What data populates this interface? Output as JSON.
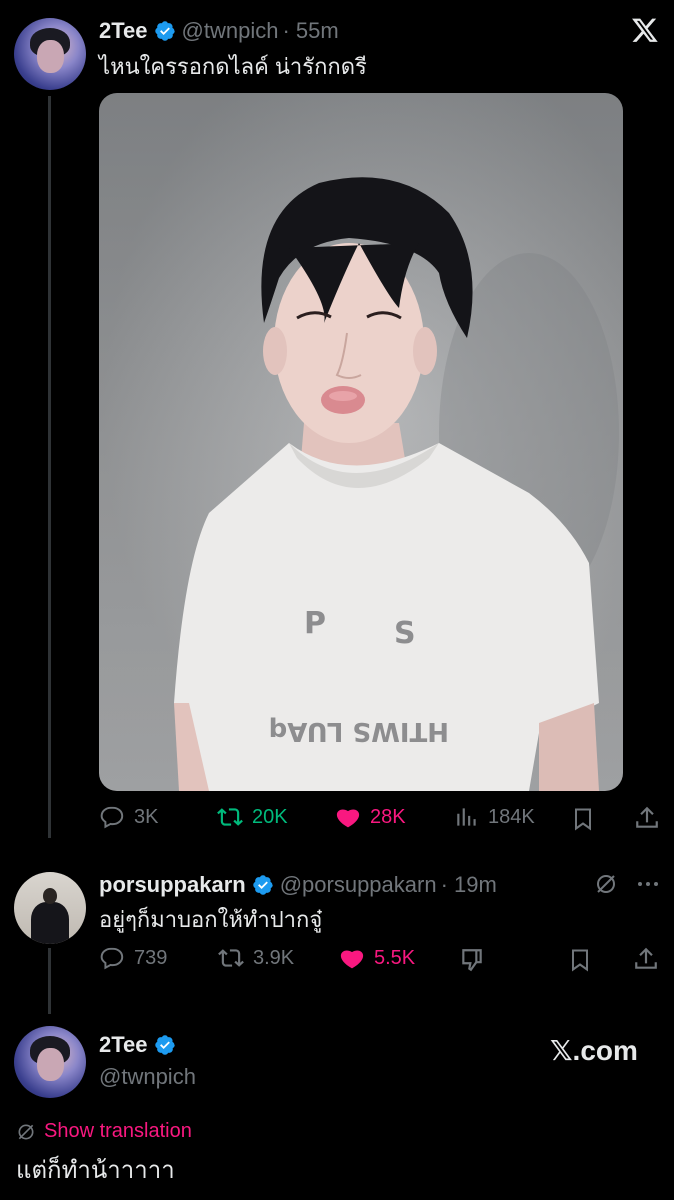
{
  "tweet": {
    "author_name": "2Tee",
    "author_handle": "@twnpich",
    "time": "· 55m",
    "text": "ไหนใครรอกดไลค์ น่ารักกดรี",
    "stats": {
      "replies": "3K",
      "retweets": "20K",
      "likes": "28K",
      "views": "184K"
    }
  },
  "reply": {
    "author_name": "porsuppakarn",
    "author_handle": "@porsuppakarn",
    "time": "· 19m",
    "text": "อยู่ๆก็มาบอกให้ทำปากจู๋",
    "stats": {
      "replies": "739",
      "retweets": "3.9K",
      "likes": "5.5K"
    }
  },
  "quote_footer": {
    "author_name": "2Tee",
    "author_handle": "@twnpich",
    "brand": "𝕏.com",
    "show_translation": "Show translation",
    "text": "แต่ก็ทำน้าาาาา"
  },
  "colors": {
    "background": "#000000",
    "text": "#e7e9ea",
    "muted": "#71767b",
    "verified": "#1d9bf0",
    "retweet": "#00ba7c",
    "like": "#f91880"
  },
  "icons": {
    "close": "x-logo-icon",
    "verified": "verified-badge-icon",
    "reply": "reply-icon",
    "retweet": "retweet-icon",
    "like": "heart-icon",
    "views": "views-icon",
    "bookmark": "bookmark-icon",
    "share": "share-icon",
    "grok": "grok-icon",
    "more": "more-icon",
    "dislike": "downvote-icon"
  }
}
